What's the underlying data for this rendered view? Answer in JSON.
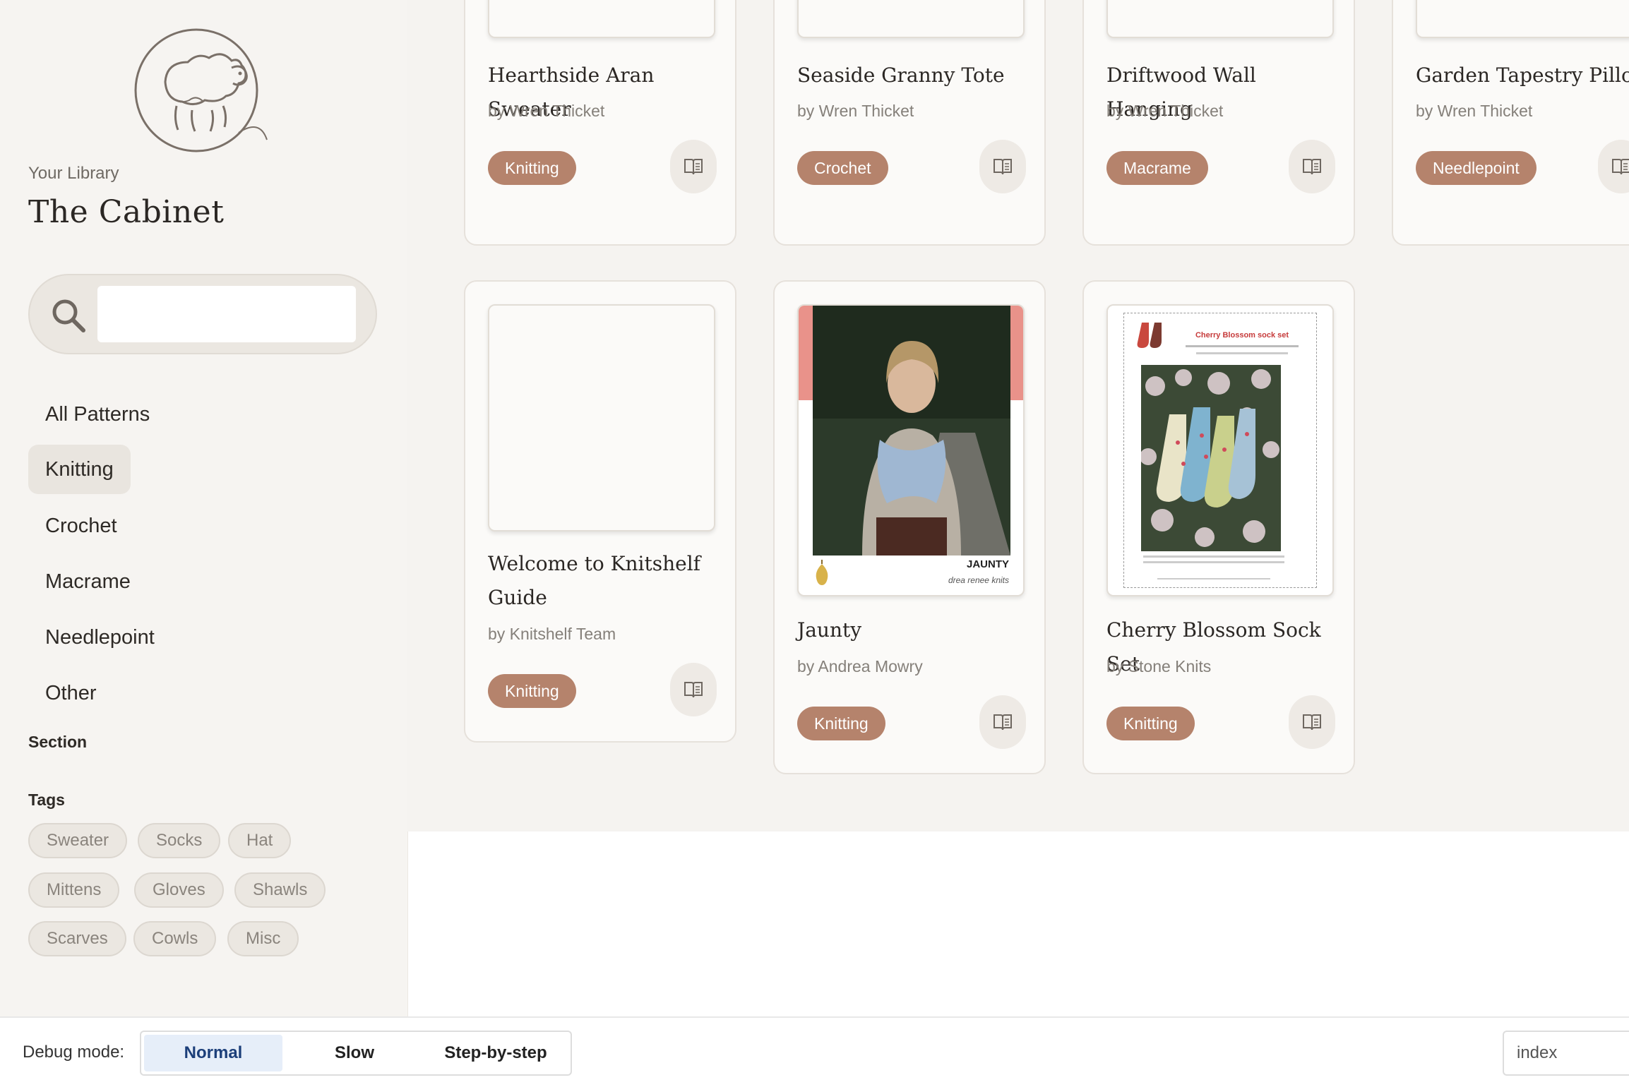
{
  "sidebar": {
    "subtitle": "Your Library",
    "title": "The Cabinet",
    "search": {
      "value": "",
      "placeholder": ""
    },
    "nav": [
      {
        "label": "All Patterns",
        "active": false
      },
      {
        "label": "Knitting",
        "active": true
      },
      {
        "label": "Crochet",
        "active": false
      },
      {
        "label": "Macrame",
        "active": false
      },
      {
        "label": "Needlepoint",
        "active": false
      },
      {
        "label": "Other",
        "active": false
      }
    ],
    "section_label": "Section",
    "tags_label": "Tags",
    "tags": [
      "Sweater",
      "Socks",
      "Hat",
      "Mittens",
      "Gloves",
      "Shawls",
      "Scarves",
      "Cowls",
      "Misc"
    ]
  },
  "cards": [
    {
      "title": "Hearthside Aran Sweater",
      "author": "by Wren Thicket",
      "category": "Knitting"
    },
    {
      "title": "Seaside Granny Tote",
      "author": "by Wren Thicket",
      "category": "Crochet"
    },
    {
      "title": "Driftwood Wall Hanging",
      "author": "by Wren Thicket",
      "category": "Macrame"
    },
    {
      "title": "Garden Tapestry Pillow",
      "author": "by Wren Thicket",
      "category": "Needlepoint"
    },
    {
      "title": "Welcome to Knitshelf Guide",
      "author": "by Knitshelf Team",
      "category": "Knitting"
    },
    {
      "title": "Jaunty",
      "author": "by Andrea Mowry",
      "category": "Knitting",
      "cover_text": {
        "name": "JAUNTY",
        "brand": "drea renee knits"
      }
    },
    {
      "title": "Cherry Blossom Sock Set",
      "author": "by Stone Knits",
      "category": "Knitting",
      "cover_text": {
        "heading": "Cherry Blossom sock set"
      }
    }
  ],
  "debug": {
    "label": "Debug mode:",
    "options": [
      "Normal",
      "Slow",
      "Step-by-step"
    ],
    "active": "Normal",
    "route": "index"
  },
  "colors": {
    "accent": "#b5836c",
    "sidebar_bg": "#f6f4f1",
    "main_bg": "#f5f3f0"
  }
}
